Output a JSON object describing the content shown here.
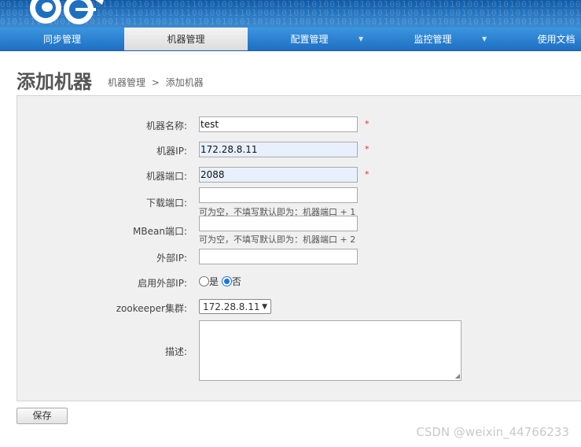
{
  "nav": {
    "items": [
      {
        "label": "同步管理"
      },
      {
        "label": "机器管理",
        "active": true
      },
      {
        "label": "配置管理"
      },
      {
        "label": "监控管理"
      },
      {
        "label": "使用文档"
      }
    ]
  },
  "page": {
    "title": "添加机器",
    "breadcrumb": [
      "机器管理",
      ">",
      "添加机器"
    ]
  },
  "form": {
    "name": {
      "label": "机器名称:",
      "value": "test",
      "required": "*"
    },
    "ip": {
      "label": "机器IP:",
      "value": "172.28.8.11",
      "required": "*"
    },
    "port": {
      "label": "机器端口:",
      "value": "2088",
      "required": "*"
    },
    "download_port": {
      "label": "下载端口:",
      "value": "",
      "hint": "可为空，不填写默认即为：机器端口 + 1"
    },
    "mbean_port": {
      "label": "MBean端口:",
      "value": "",
      "hint": "可为空，不填写默认即为：机器端口 + 2"
    },
    "external_ip": {
      "label": "外部IP:",
      "value": ""
    },
    "use_external_ip": {
      "label": "启用外部IP:",
      "options": [
        "是",
        "否"
      ],
      "selected": "否"
    },
    "zookeeper": {
      "label": "zookeeper集群:",
      "selected": "172.28.8.11"
    },
    "description": {
      "label": "描述:",
      "value": ""
    }
  },
  "actions": {
    "save_label": "保存"
  },
  "watermark": "CSDN @weixin_44766233",
  "colors": {
    "nav_blue": "#2a7fd0",
    "required_red": "#dd3333",
    "autofill_bg": "#e8f0fe",
    "radio_blue": "#1a73e8"
  }
}
